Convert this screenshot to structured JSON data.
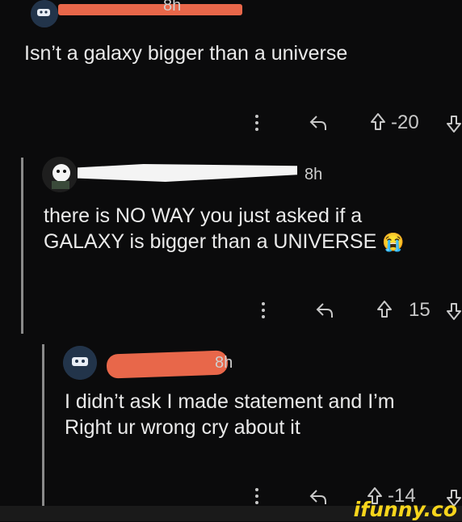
{
  "colors": {
    "background": "#0b0b0c",
    "redaction_orange": "#e8674a",
    "redaction_white": "#f4f4f4",
    "ifunny_yellow": "#f7d51c"
  },
  "comments": [
    {
      "time": "8h",
      "text": "Isn’t a galaxy bigger than a universe",
      "score": "-20",
      "icons": [
        "more-vertical-icon",
        "reply-arrow-icon",
        "upvote-icon",
        "downvote-icon"
      ]
    },
    {
      "time": "8h",
      "text_line1": "there is NO WAY you just asked if a",
      "text_line2": "GALAXY is bigger than a UNIVERSE",
      "emoji": "😭",
      "score": "15",
      "icons": [
        "more-vertical-icon",
        "reply-arrow-icon",
        "upvote-icon",
        "downvote-icon"
      ]
    },
    {
      "time": "8h",
      "text_line1": "I didn’t ask I made statement and I’m",
      "text_line2": "Right ur wrong cry about it",
      "score": "-14",
      "icons": [
        "more-vertical-icon",
        "reply-arrow-icon",
        "upvote-icon",
        "downvote-icon"
      ]
    }
  ],
  "watermark": "ifunny.co"
}
